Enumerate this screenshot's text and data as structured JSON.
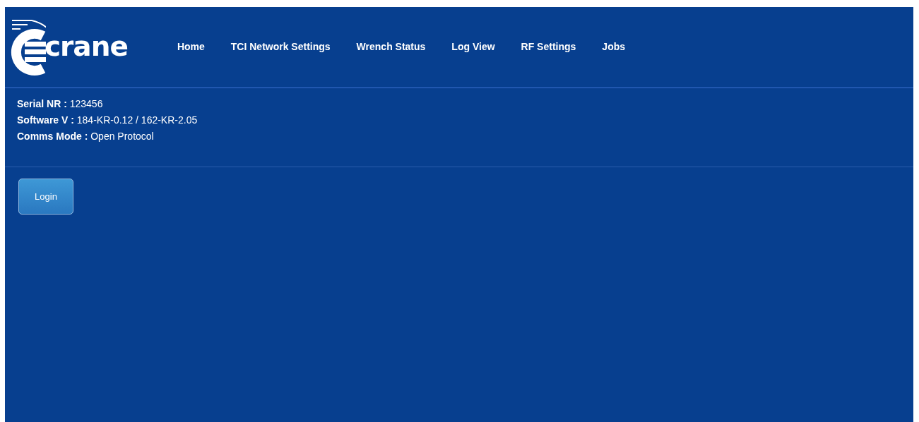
{
  "logo": {
    "text": "crane"
  },
  "nav": [
    "Home",
    "TCI Network Settings",
    "Wrench Status",
    "Log View",
    "RF Settings",
    "Jobs"
  ],
  "info": [
    {
      "label": "Serial NR :",
      "value": "123456"
    },
    {
      "label": "Software V :",
      "value": "184-KR-0.12 / 162-KR-2.05"
    },
    {
      "label": "Comms Mode :",
      "value": "Open Protocol"
    }
  ],
  "login_button": "Login"
}
